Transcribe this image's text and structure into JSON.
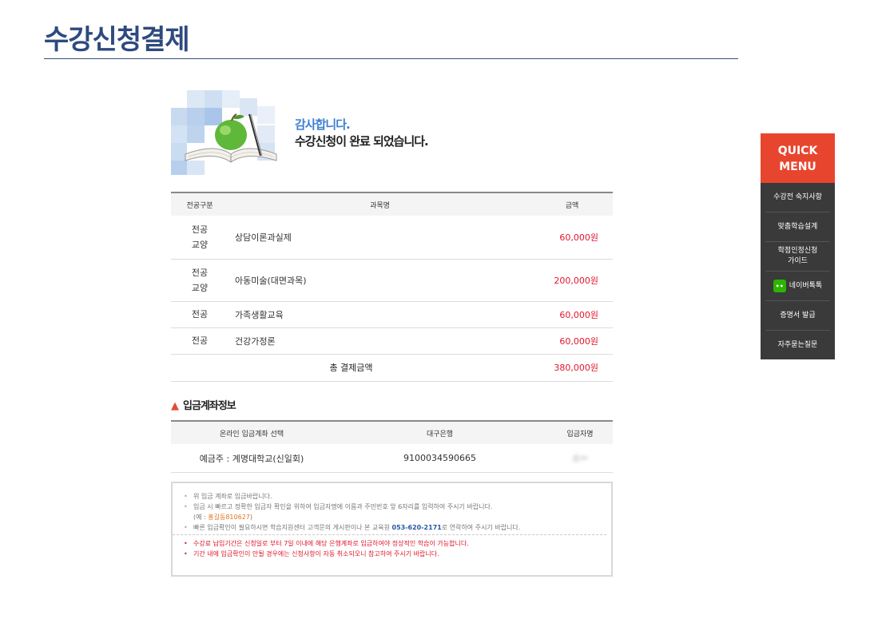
{
  "page": {
    "title": "수강신청결제"
  },
  "hero": {
    "line1": "감사합니다.",
    "line2": "수강신청이 완료 되었습니다."
  },
  "order_table": {
    "headers": [
      "전공구분",
      "과목명",
      "금액"
    ],
    "rows": [
      {
        "division": "전공\n교양",
        "subject": "상담이론과실제",
        "amount": "60,000원"
      },
      {
        "division": "전공\n교양",
        "subject": "아동미술(대면과목)",
        "amount": "200,000원"
      },
      {
        "division": "전공",
        "subject": "가족생활교육",
        "amount": "60,000원"
      },
      {
        "division": "전공",
        "subject": "건강가정론",
        "amount": "60,000원"
      }
    ],
    "total_label": "총 결제금액",
    "total_amount": "380,000원"
  },
  "bank_section": {
    "title": "입금계좌정보",
    "headers": [
      "온라인 입금계좌 선택",
      "대구은행",
      "입금자명"
    ],
    "account_holder": "예금주 : 계명대학교(신일회)",
    "account_number": "9100034590665",
    "depositor_name": "조**"
  },
  "notice": {
    "items": [
      "위 입금 계좌로 입금바랍니다.",
      "입금 시 빠르고 정확한 입금자 확인을 위하여 입금자명에 이름과 주민번호 앞 6자리를 입력하여 주시기 바랍니다."
    ],
    "example_prefix": "(예 : ",
    "example_value": "홍길동810627",
    "example_suffix": ")",
    "phone_prefix": "빠른 입금확인이 필요하시면 학습지원센터 고객문의 게시판이나 본 교육원 ",
    "phone": "053-620-2171",
    "phone_suffix": "로 연락하여 주시기 바랍니다.",
    "red_items": [
      "수강료 납입기간은 신청일로 부터 7일 이내에 해당 은행계좌로 입금하여야 정상적인 학습이 가능합니다.",
      "기간 내에 입금확인이 안될 경우에는 신청사항이 자동 취소되오니 참고하여 주시기 바랍니다."
    ]
  },
  "quick_menu": {
    "title_line1": "QUICK",
    "title_line2": "MENU",
    "items": [
      "수강전 숙지사항",
      "맞춤학습설계",
      "학점인정신청\n가이드",
      "네이버톡톡",
      "증명서 발급",
      "자주묻는질문"
    ],
    "naver_icon_text": "••"
  },
  "colors": {
    "title": "#2e4a7e",
    "accent_red": "#e0172c",
    "quick_head": "#e8452f",
    "quick_body": "#3a3a3a",
    "hero_blue": "#3d7fd0"
  }
}
